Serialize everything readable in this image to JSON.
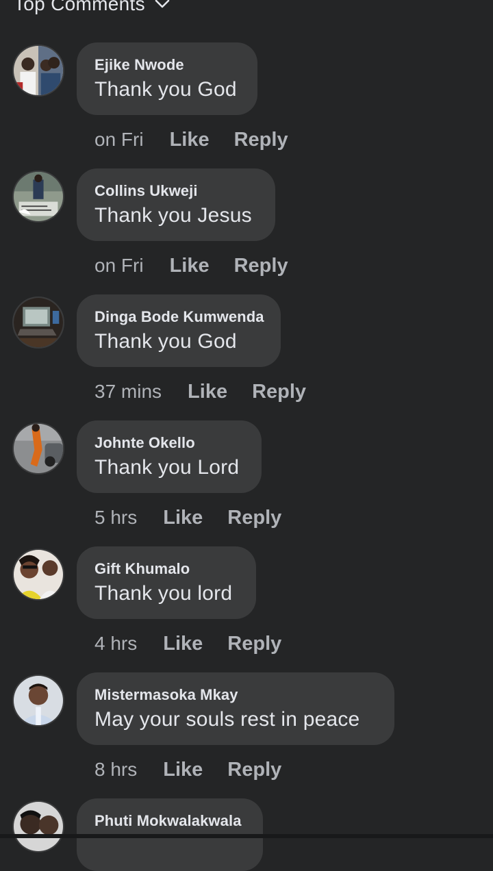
{
  "header": {
    "sort_label": "Top Comments"
  },
  "comments": [
    {
      "author": "Ejike Nwode",
      "text": "Thank you God",
      "time": "on Fri",
      "like": "Like",
      "reply": "Reply"
    },
    {
      "author": "Collins Ukweji",
      "text": "Thank you Jesus",
      "time": "on Fri",
      "like": "Like",
      "reply": "Reply"
    },
    {
      "author": "Dinga Bode Kumwenda",
      "text": "Thank you God",
      "time": "37 mins",
      "like": "Like",
      "reply": "Reply"
    },
    {
      "author": "Johnte Okello",
      "text": "Thank you Lord",
      "time": "5 hrs",
      "like": "Like",
      "reply": "Reply"
    },
    {
      "author": "Gift Khumalo",
      "text": "Thank you lord",
      "time": "4 hrs",
      "like": "Like",
      "reply": "Reply"
    },
    {
      "author": "Mistermasoka Mkay",
      "text": "May your souls rest in peace",
      "time": "8 hrs",
      "like": "Like",
      "reply": "Reply"
    },
    {
      "author": "Phuti Mokwalakwala"
    }
  ]
}
